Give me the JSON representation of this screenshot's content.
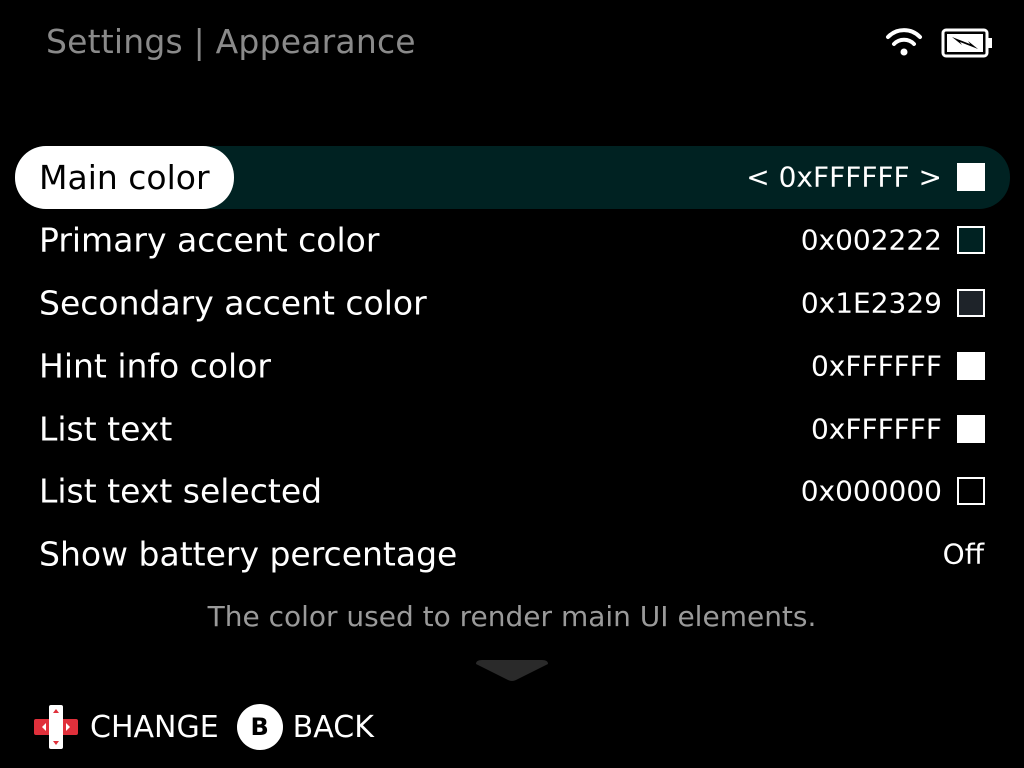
{
  "header": {
    "title": "Settings | Appearance",
    "status_icons": [
      "wifi-icon",
      "battery-charging-icon"
    ]
  },
  "settings": [
    {
      "label": "Main color",
      "value": "< 0xFFFFFF >",
      "swatch": "#FFFFFF",
      "selected": true
    },
    {
      "label": "Primary accent color",
      "value": "0x002222",
      "swatch": "#002222",
      "selected": false
    },
    {
      "label": "Secondary accent color",
      "value": "0x1E2329",
      "swatch": "#1E2329",
      "selected": false
    },
    {
      "label": "Hint info color",
      "value": "0xFFFFFF",
      "swatch": "#FFFFFF",
      "selected": false
    },
    {
      "label": "List text",
      "value": "0xFFFFFF",
      "swatch": "#FFFFFF",
      "selected": false
    },
    {
      "label": "List text selected",
      "value": "0x000000",
      "swatch": "#000000",
      "selected": false
    },
    {
      "label": "Show battery percentage",
      "value": "Off",
      "swatch": null,
      "selected": false
    }
  ],
  "hint": "The color used to render main UI elements.",
  "footer": {
    "change_label": "CHANGE",
    "back_button_glyph": "B",
    "back_label": "BACK"
  },
  "colors": {
    "background": "#000000",
    "selected_row": "#002222",
    "title": "#8A8A8A",
    "hint": "#9A9A9A",
    "dpad_accent": "#E0303B"
  }
}
